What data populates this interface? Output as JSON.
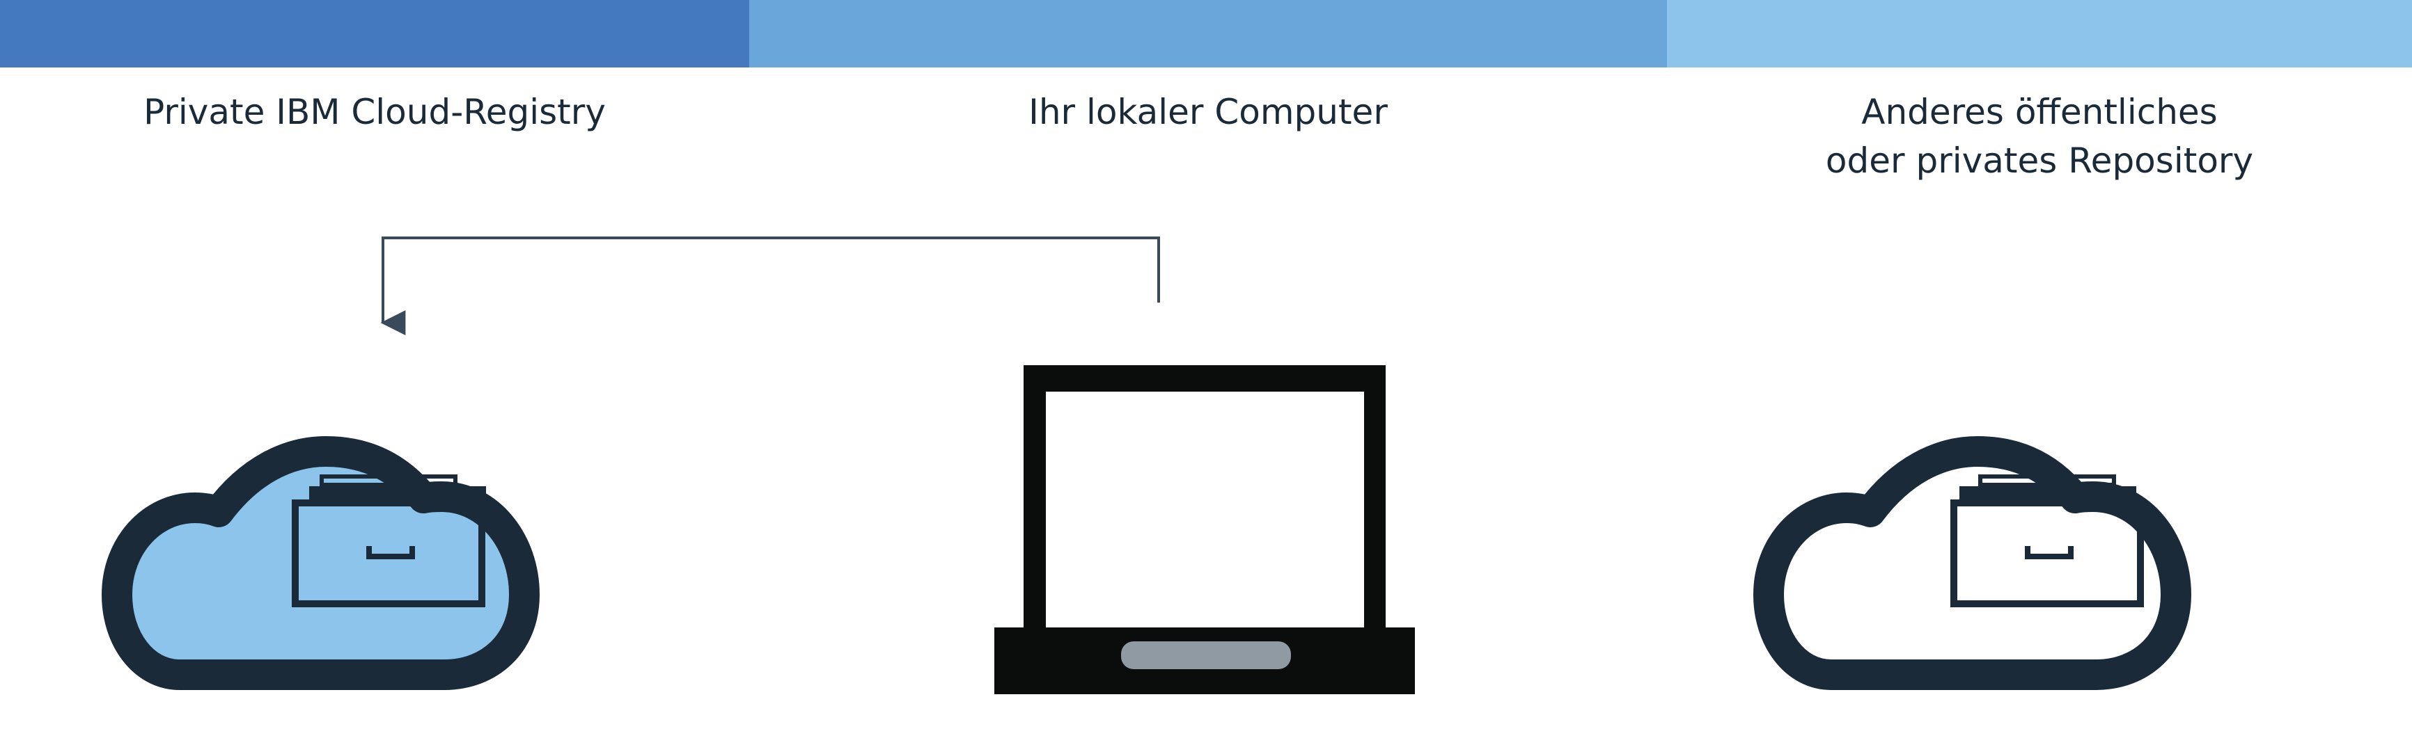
{
  "colors": {
    "band_dark": "#4479c0",
    "band_mid": "#6ba6da",
    "band_light": "#8cc4ec",
    "cloud_fill": "#8cc4ec",
    "outline": "#1b2a38",
    "laptop_body": "#0a0d0c",
    "trackpad": "#8f9aa3",
    "arrow": "#3a4a5a"
  },
  "columns": [
    {
      "label_lines": [
        "Private IBM Cloud-Registry"
      ]
    },
    {
      "label_lines": [
        "Ihr lokaler Computer"
      ]
    },
    {
      "label_lines": [
        "Anderes öffentliches",
        "oder privates Repository"
      ]
    }
  ],
  "icons": {
    "cloud_private": "cloud-with-drawer-icon",
    "computer": "laptop-icon",
    "cloud_other": "cloud-with-drawer-icon"
  }
}
